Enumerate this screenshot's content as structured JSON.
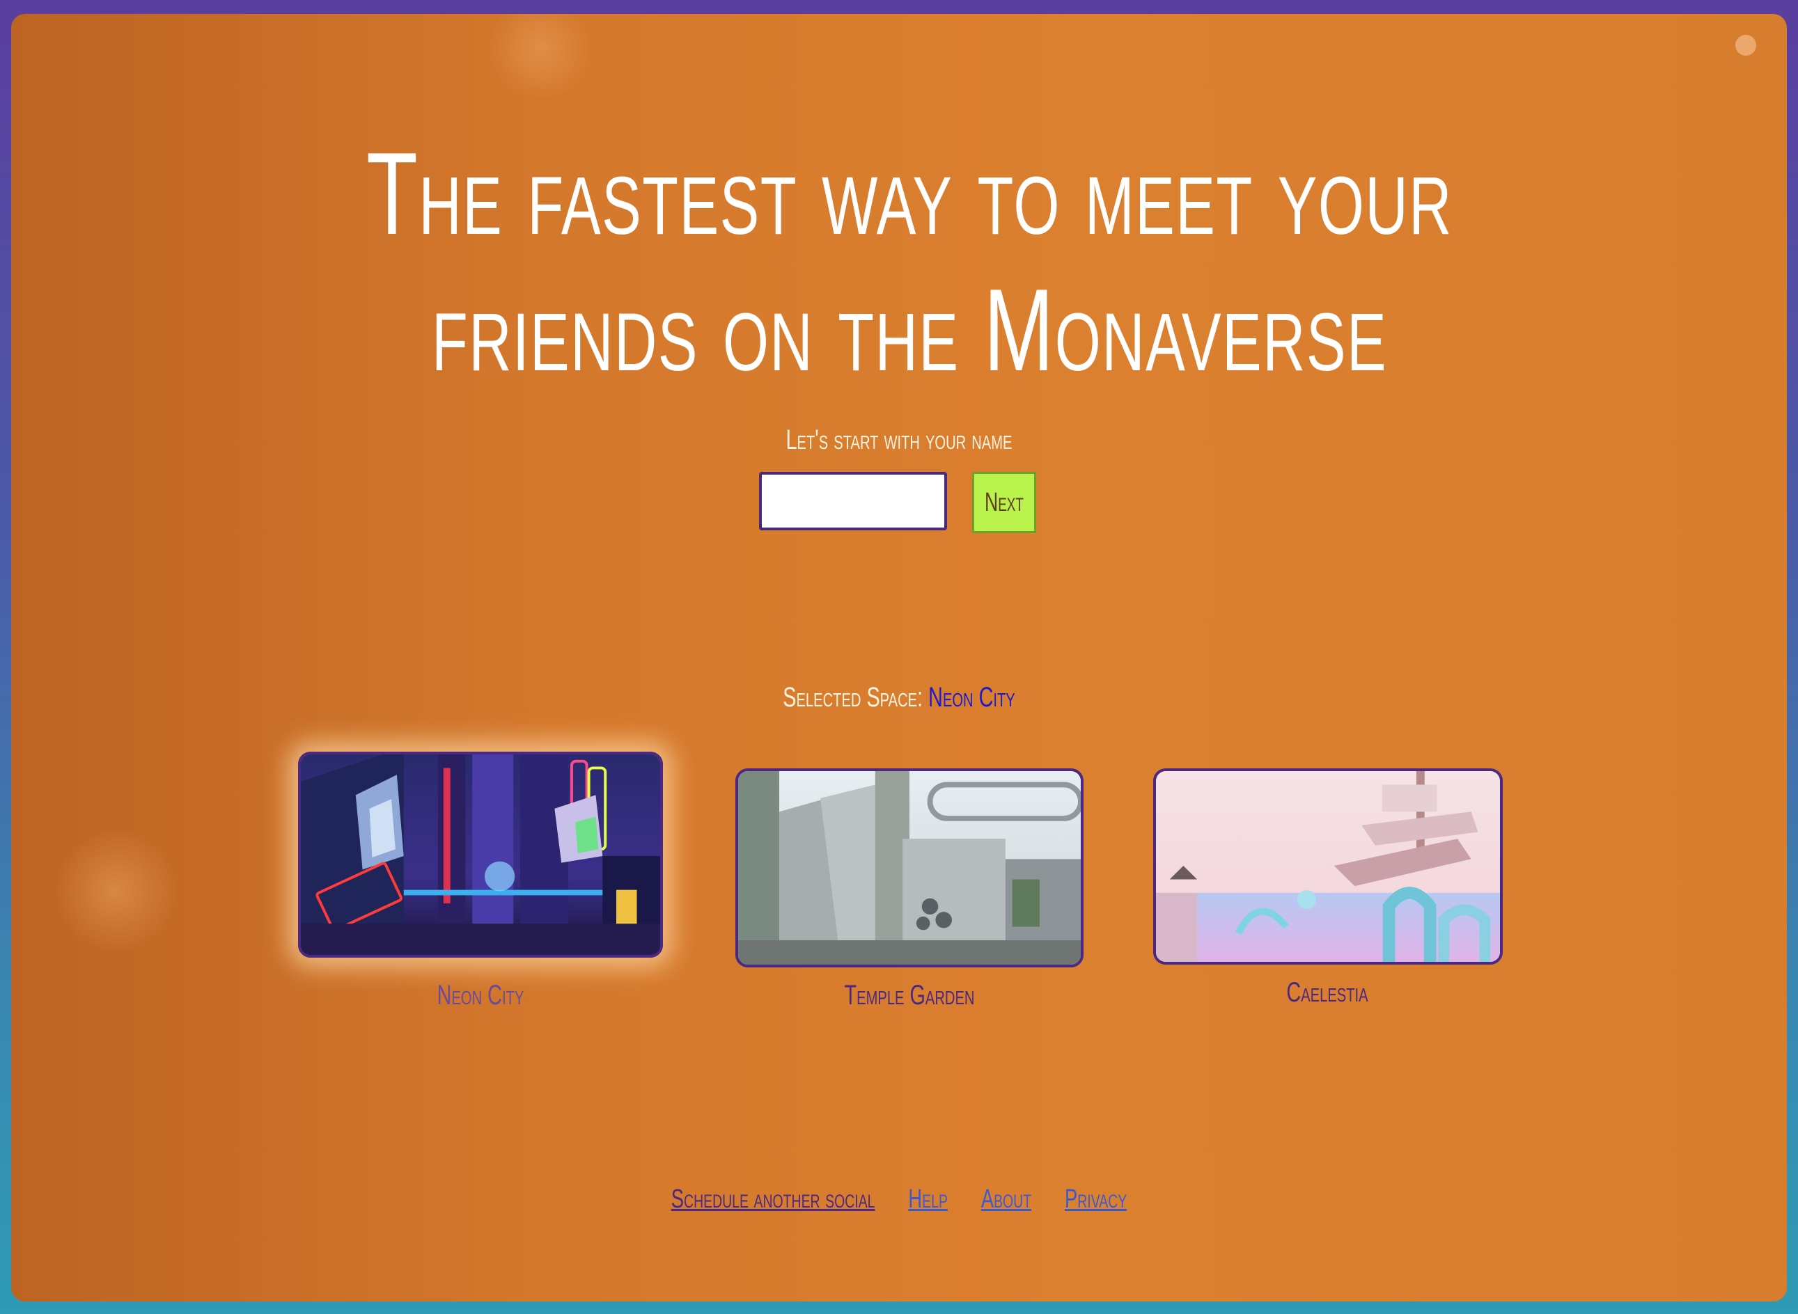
{
  "hero": {
    "headline": "The fastest way to meet your friends on the Monaverse",
    "prompt": "Let's start with your name"
  },
  "form": {
    "name_value": "",
    "next_label": "Next"
  },
  "selection": {
    "label": "Selected Space:",
    "value": "Neon City"
  },
  "spaces": [
    {
      "name": "Neon City",
      "selected": true,
      "thumbnail_icon": "neon-city-thumbnail"
    },
    {
      "name": "Temple Garden",
      "selected": false,
      "thumbnail_icon": "temple-garden-thumbnail"
    },
    {
      "name": "Caelestia",
      "selected": false,
      "thumbnail_icon": "caelestia-thumbnail"
    }
  ],
  "footer": {
    "links": [
      "Schedule another social",
      "Help",
      "About",
      "Privacy"
    ]
  },
  "colors": {
    "background_orange": "#d77d2e",
    "accent_purple": "#4b2882",
    "next_button_green": "#b9f24a",
    "selected_value_blue": "#1e1ad0",
    "link_blue": "#3c5ad0"
  }
}
